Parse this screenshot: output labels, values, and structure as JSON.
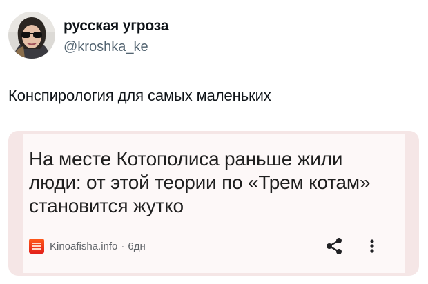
{
  "tweet": {
    "display_name": "русская угроза",
    "handle": "@kroshka_ke",
    "text": "Конспирология для самых маленьких"
  },
  "card": {
    "headline": "На месте Котополиса раньше жили люди: от этой теории по «Трем котам» становится жутко",
    "source": {
      "name": "Kinoafisha.info",
      "separator": "·",
      "age": "6дн",
      "logo_color": "#e3201b"
    },
    "actions": {
      "share_icon": "share-icon",
      "more_icon": "more-vertical-icon"
    }
  },
  "colors": {
    "card_outer": "#f5e6e6",
    "card_inner": "#fdf8f8",
    "handle_text": "#536471"
  }
}
